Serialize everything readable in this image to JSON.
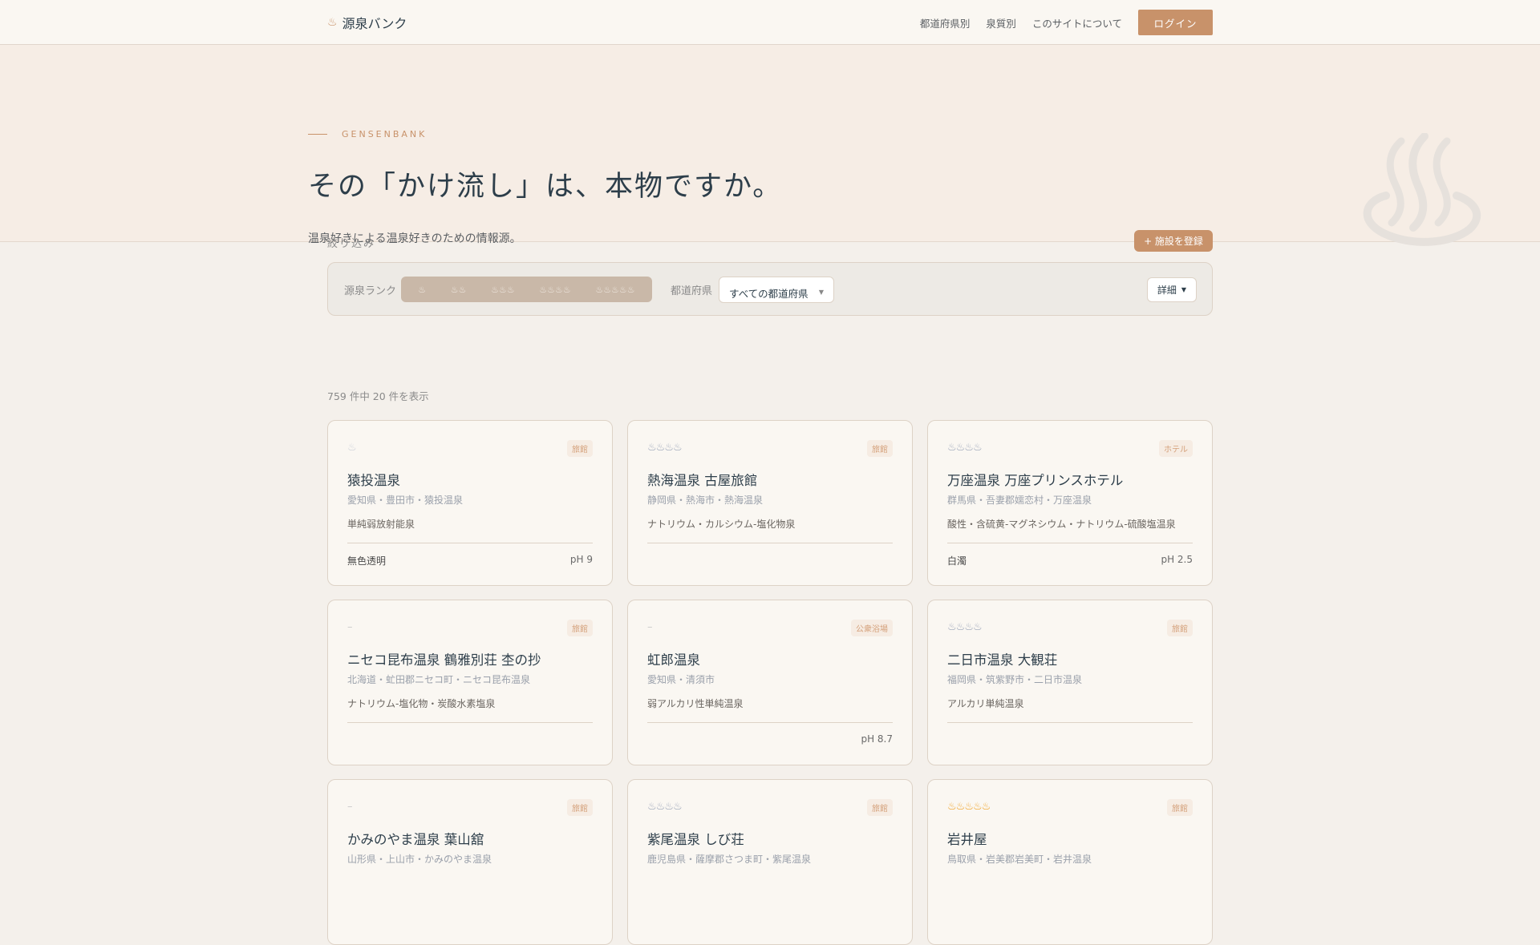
{
  "header": {
    "logo": "源泉バンク",
    "logo_icon": "♨",
    "nav": [
      "都道府県別",
      "泉質別",
      "このサイトについて"
    ],
    "login": "ログイン"
  },
  "hero": {
    "eyebrow": "GENSENBANK",
    "title": "その「かけ流し」は、本物ですか。",
    "subtitle": "温泉好きによる温泉好きのための情報源。"
  },
  "filter": {
    "label": "絞り込み",
    "add_button": "+ 施設を登録",
    "rank_label": "源泉ランク",
    "rank_options": [
      "♨",
      "♨♨",
      "♨♨♨",
      "♨♨♨♨",
      "♨♨♨♨♨"
    ],
    "pref_label": "都道府県",
    "pref_value": "すべての都道府県",
    "detail": "詳細"
  },
  "count": "759 件中 20 件を表示",
  "cards": [
    {
      "rank": "♨",
      "rank_level": 1,
      "type": "旅館",
      "name": "猿投温泉",
      "location": "愛知県・豊田市・猿投温泉",
      "spring": "単純弱放射能泉",
      "color": "無色透明",
      "ph": "pH 9"
    },
    {
      "rank": "♨♨♨♨",
      "rank_level": 4,
      "type": "旅館",
      "name": "熱海温泉 古屋旅館",
      "location": "静岡県・熱海市・熱海温泉",
      "spring": "ナトリウム・カルシウム-塩化物泉",
      "color": "",
      "ph": ""
    },
    {
      "rank": "♨♨♨♨",
      "rank_level": 4,
      "type": "ホテル",
      "name": "万座温泉 万座プリンスホテル",
      "location": "群馬県・吾妻郡嬬恋村・万座温泉",
      "spring": "酸性・含硫黄-マグネシウム・ナトリウム-硫酸塩温泉",
      "color": "白濁",
      "ph": "pH 2.5"
    },
    {
      "rank": "–",
      "rank_level": 0,
      "type": "旅館",
      "name": "ニセコ昆布温泉 鶴雅別荘 杢の抄",
      "location": "北海道・虻田郡ニセコ町・ニセコ昆布温泉",
      "spring": "ナトリウム-塩化物・炭酸水素塩泉",
      "color": "",
      "ph": ""
    },
    {
      "rank": "–",
      "rank_level": 0,
      "type": "公衆浴場",
      "name": "虹郎温泉",
      "location": "愛知県・清須市",
      "spring": "弱アルカリ性単純温泉",
      "color": "",
      "ph": "pH 8.7"
    },
    {
      "rank": "♨♨♨♨",
      "rank_level": 4,
      "type": "旅館",
      "name": "二日市温泉 大観荘",
      "location": "福岡県・筑紫野市・二日市温泉",
      "spring": "アルカリ単純温泉",
      "color": "",
      "ph": ""
    },
    {
      "rank": "–",
      "rank_level": 0,
      "type": "旅館",
      "name": "かみのやま温泉 葉山舘",
      "location": "山形県・上山市・かみのやま温泉",
      "spring": "",
      "color": "",
      "ph": ""
    },
    {
      "rank": "♨♨♨♨",
      "rank_level": 4,
      "type": "旅館",
      "name": "紫尾温泉 しび荘",
      "location": "鹿児島県・薩摩郡さつま町・紫尾温泉",
      "spring": "",
      "color": "",
      "ph": ""
    },
    {
      "rank": "♨♨♨♨♨",
      "rank_level": 5,
      "type": "旅館",
      "name": "岩井屋",
      "location": "鳥取県・岩美郡岩美町・岩井温泉",
      "spring": "",
      "color": "",
      "ph": ""
    }
  ]
}
